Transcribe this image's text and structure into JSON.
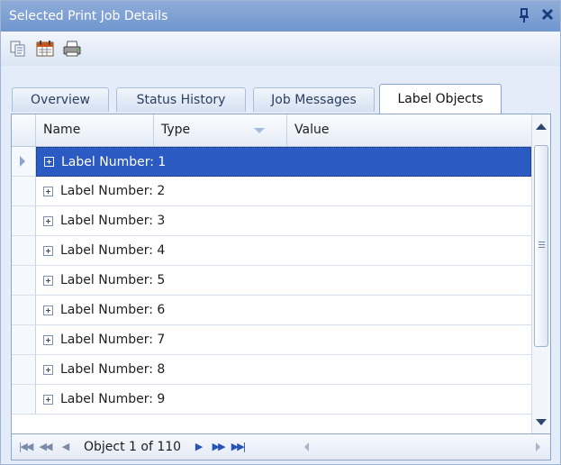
{
  "window": {
    "title": "Selected Print Job Details",
    "pin_glyph": "p",
    "close_glyph": "✕"
  },
  "toolbar": {
    "icons": [
      "copy-icon",
      "calendar-icon",
      "printer-icon"
    ]
  },
  "tabs": [
    {
      "label": "Overview",
      "active": false
    },
    {
      "label": "Status History",
      "active": false
    },
    {
      "label": "Job Messages",
      "active": false
    },
    {
      "label": "Label Objects",
      "active": true
    }
  ],
  "grid": {
    "columns": [
      {
        "label": "Name"
      },
      {
        "label": "Type"
      },
      {
        "label": "Value"
      }
    ],
    "rows": [
      {
        "label": "Label Number: 1",
        "selected": true
      },
      {
        "label": "Label Number: 2",
        "selected": false
      },
      {
        "label": "Label Number: 3",
        "selected": false
      },
      {
        "label": "Label Number: 4",
        "selected": false
      },
      {
        "label": "Label Number: 5",
        "selected": false
      },
      {
        "label": "Label Number: 6",
        "selected": false
      },
      {
        "label": "Label Number: 7",
        "selected": false
      },
      {
        "label": "Label Number: 8",
        "selected": false
      },
      {
        "label": "Label Number: 9",
        "selected": false
      }
    ]
  },
  "navigator": {
    "record_text": "Object 1 of 110"
  },
  "colors": {
    "accent": "#2a5ac2",
    "title_bar": "#7f9fd3",
    "border": "#8aa6cf"
  }
}
